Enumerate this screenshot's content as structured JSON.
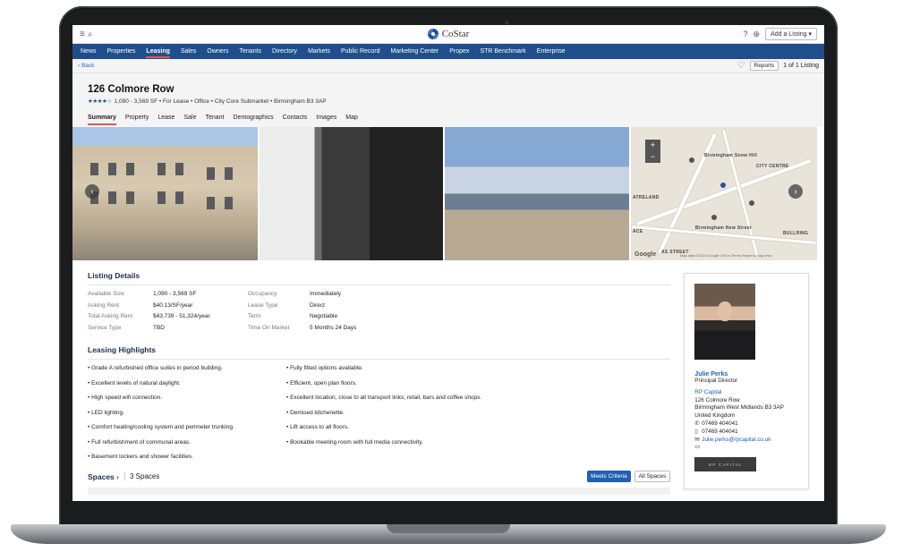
{
  "topbar": {
    "menu_icon": "≡",
    "search_icon": "⌕",
    "logo_text": "CoStar",
    "add_listing": "Add a Listing ▾"
  },
  "nav": [
    "News",
    "Properties",
    "Leasing",
    "Sales",
    "Owners",
    "Tenants",
    "Directory",
    "Markets",
    "Public Record",
    "Marketing Center",
    "Propex",
    "STR Benchmark",
    "Enterprise"
  ],
  "nav_active": "Leasing",
  "subbar": {
    "back": "‹ Back",
    "reports": "Reports",
    "listing_count": "1 of 1 Listing"
  },
  "listing": {
    "title": "126 Colmore Row",
    "stars": "★★★★☆",
    "meta": "1,090 - 3,569 SF  •  For Lease  •  Office  •  City Core Submarket  •  Birmingham B3 3AP"
  },
  "tabs": [
    "Summary",
    "Property",
    "Lease",
    "Sale",
    "Tenant",
    "Demographics",
    "Contacts",
    "Images",
    "Map"
  ],
  "map": {
    "labels": [
      "Birmingham Snow Hill",
      "CITY CENTRE",
      "ATRELAND",
      "Birmingham New Street",
      "BULLRING",
      "AS STREET",
      "ACE"
    ],
    "google": "Google",
    "data_note": "Map data ©2024 Google  100 m  Terms  Report a map error",
    "mode_button": "Map"
  },
  "details": {
    "title": "Listing Details",
    "rows": [
      [
        "Available Size",
        "1,090 - 3,569 SF",
        "Occupancy",
        "Immediately"
      ],
      [
        "Asking Rent",
        "$40.13/SF/year",
        "Lease Type",
        "Direct"
      ],
      [
        "Total Asking Rent",
        "$43,739 - 51,324/year",
        "Term",
        "Negotiable"
      ],
      [
        "Service Type",
        "TBD",
        "Time On Market",
        "5 Months 24 Days"
      ]
    ]
  },
  "highlights": {
    "title": "Leasing Highlights",
    "left": [
      "• Grade A refurbished office suites in period building.",
      "• Excellent levels of natural daylight.",
      "• High speed wifi connection.",
      "• LED lighting.",
      "• Comfort heating/cooling system and perimeter trunking.",
      "• Full refurbishment of communal areas.",
      "• Basement lockers and shower facilities."
    ],
    "right": [
      "• Fully fitted options available.",
      "• Efficient, open plan floors.",
      "• Excellent location, close to all transport links, retail, bars and coffee shops.",
      "• Demised kitchenette.",
      "• Lift access to all floors.",
      "• Bookable meeting room with full media connectivity.",
      ""
    ]
  },
  "spaces": {
    "title": "Spaces",
    "chevron": "›",
    "count": "3 Spaces",
    "meets_criteria": "Meets Criteria",
    "all_spaces": "All Spaces"
  },
  "contact": {
    "name": "Julie Perks",
    "role": "Principal Director",
    "company": "RP Capital",
    "address1": "126 Colmore Row",
    "address2": "Birmingham West Midlands B3 3AP",
    "country": "United Kingdom",
    "phone": "07469 404041",
    "mobile": "07469 404041",
    "email": "Julie.perks@rpcapital.co.uk",
    "logo_text": "RP CAPITAL"
  },
  "colors": {
    "nav_bg": "#1f4e8c",
    "accent_red": "#e2574c",
    "link_blue": "#1f5fb4"
  }
}
